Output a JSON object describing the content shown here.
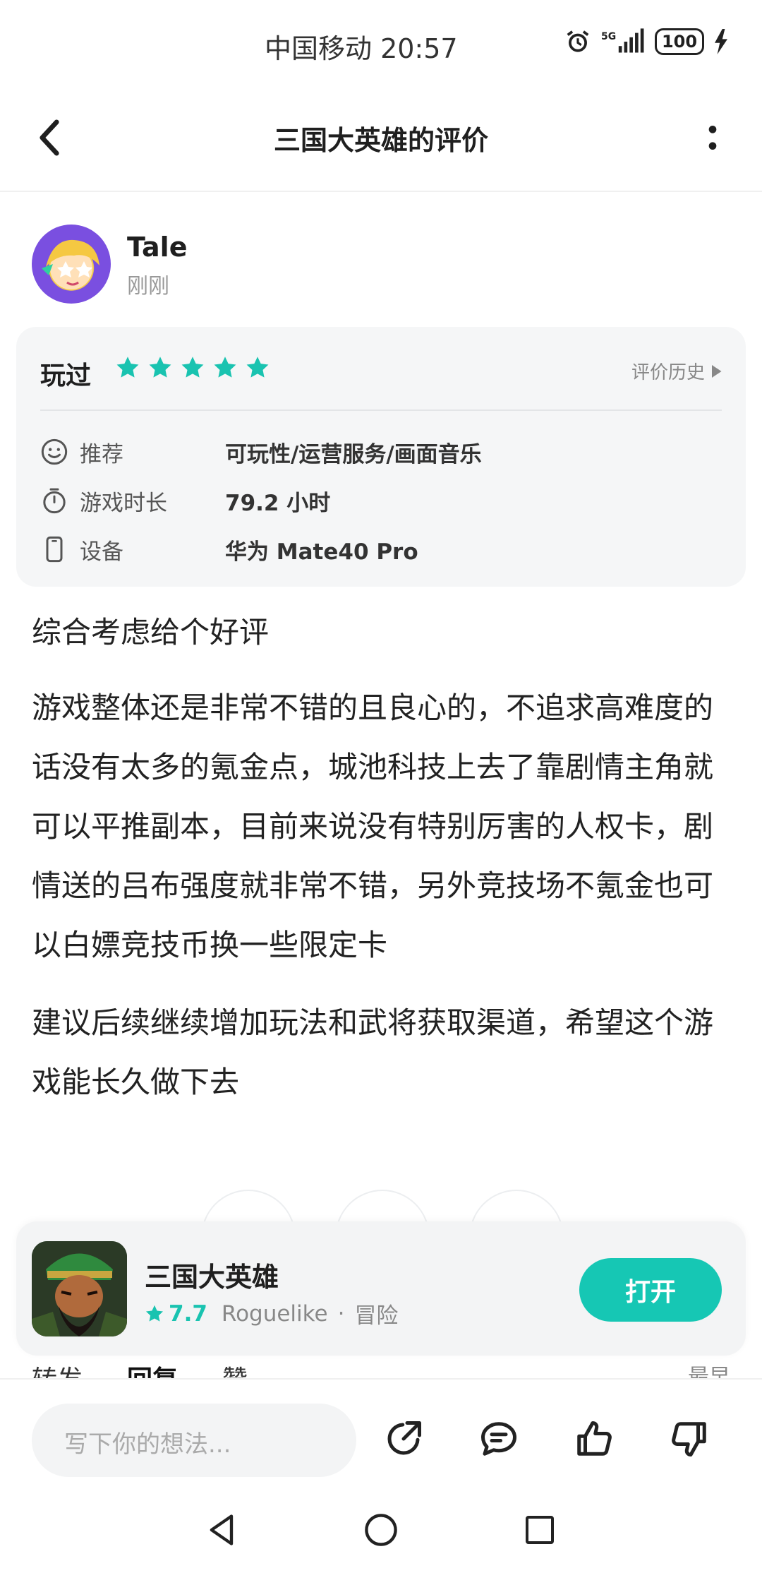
{
  "status_bar": {
    "carrier_time": "中国移动 20:57",
    "battery": "100"
  },
  "header": {
    "title": "三国大英雄的评价"
  },
  "user": {
    "name": "Tale",
    "time": "刚刚"
  },
  "review_card": {
    "played_label": "玩过",
    "rating_stars": 5,
    "history_link": "评价历史",
    "rows": [
      {
        "icon": "smile-icon",
        "label": "推荐",
        "value": "可玩性/运营服务/画面音乐"
      },
      {
        "icon": "timer-icon",
        "label": "游戏时长",
        "value": "79.2 小时"
      },
      {
        "icon": "phone-icon",
        "label": "设备",
        "value": "华为 Mate40 Pro"
      }
    ]
  },
  "body": {
    "paragraphs": [
      "综合考虑给个好评",
      "游戏整体还是非常不错的且良心的，不追求高难度的话没有太多的氪金点，城池科技上去了靠剧情主角就可以平推副本，目前来说没有特别厉害的人权卡，剧情送的吕布强度就非常不错，另外竞技场不氪金也可以白嫖竞技币换一些限定卡",
      "建议后续继续增加玩法和武将获取渠道，希望这个游戏能长久做下去"
    ]
  },
  "app_card": {
    "name": "三国大英雄",
    "score": "7.7",
    "tag1": "Roguelike",
    "separator": "·",
    "tag2": "冒险",
    "open_label": "打开"
  },
  "tabs": {
    "forward": "转发",
    "reply": "回复",
    "like": "赞",
    "sort": "最早"
  },
  "comment_bar": {
    "placeholder": "写下你的想法..."
  },
  "colors": {
    "accent": "#16c7b4",
    "star": "#19c3b0"
  }
}
